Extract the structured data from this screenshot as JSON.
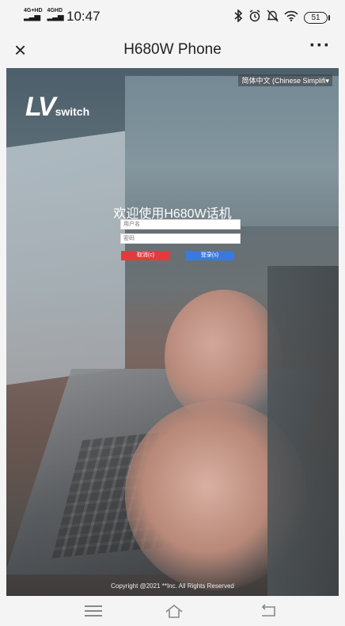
{
  "status_bar": {
    "signal1": "4G+HD",
    "signal2": "4GHD",
    "time": "10:47",
    "icons": [
      "bluetooth-icon",
      "alarm-icon",
      "mute-icon",
      "wifi-icon"
    ],
    "battery": "51"
  },
  "navbar": {
    "close_icon": "×",
    "title": "H680W Phone",
    "more_icon": "···"
  },
  "page": {
    "language": "简体中文 (Chinese Simplifi▾",
    "logo_lv": "LV",
    "logo_switch": "switch",
    "welcome": "欢迎使用H680W话机",
    "username_placeholder": "用户名",
    "password_placeholder": "密码",
    "cancel_label": "取消(c)",
    "login_label": "登录(s)",
    "copyright": "Copyright @2021 **Inc. All Rights Reserved"
  },
  "colors": {
    "cancel": "#e43a3a",
    "login": "#3a7ae0"
  }
}
